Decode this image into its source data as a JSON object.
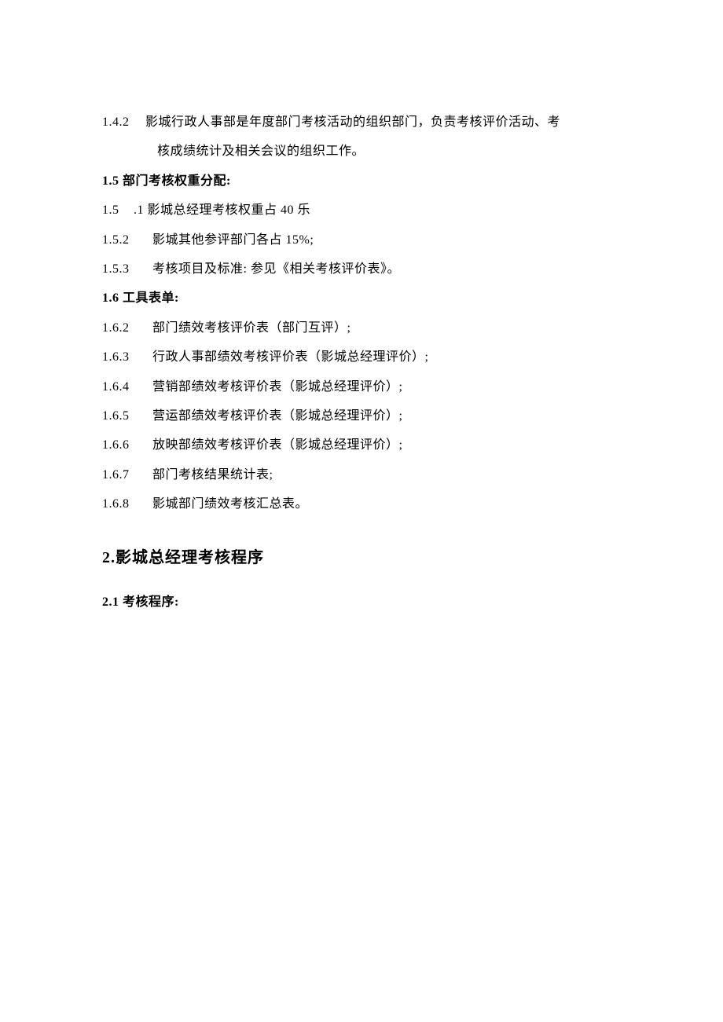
{
  "items": {
    "i142_num": "1.4.2",
    "i142_text_a": "影城行政人事部是年度部门考核活动的组织部门，负责考核评价活动、考",
    "i142_text_b": "核成绩统计及相关会议的组织工作。",
    "i15_heading": "1.5 部门考核权重分配:",
    "i151_num": "1.5",
    "i151_text": ".1 影城总经理考核权重占 40 乐",
    "i152_num": "1.5.2",
    "i152_text": "影城其他参评部门各占 15%;",
    "i153_num": "1.5.3",
    "i153_text": "考核项目及标准: 参见《相关考核评价表》。",
    "i16_heading": "1.6  工具表单:",
    "i162_num": "1.6.2",
    "i162_text": "部门绩效考核评价表（部门互评）;",
    "i163_num": "1.6.3",
    "i163_text": "行政人事部绩效考核评价表（影城总经理评价）;",
    "i164_num": "1.6.4",
    "i164_text": "营销部绩效考核评价表（影城总经理评价）;",
    "i165_num": "1.6.5",
    "i165_text": "营运部绩效考核评价表（影城总经理评价）;",
    "i166_num": "1.6.6",
    "i166_text": "放映部绩效考核评价表（影城总经理评价）;",
    "i167_num": "1.6.7",
    "i167_text": "部门考核结果统计表;",
    "i168_num": "1.6.8",
    "i168_text": "影城部门绩效考核汇总表。",
    "s2_heading": "2.影城总经理考核程序",
    "s21_heading": "2.1  考核程序:"
  }
}
